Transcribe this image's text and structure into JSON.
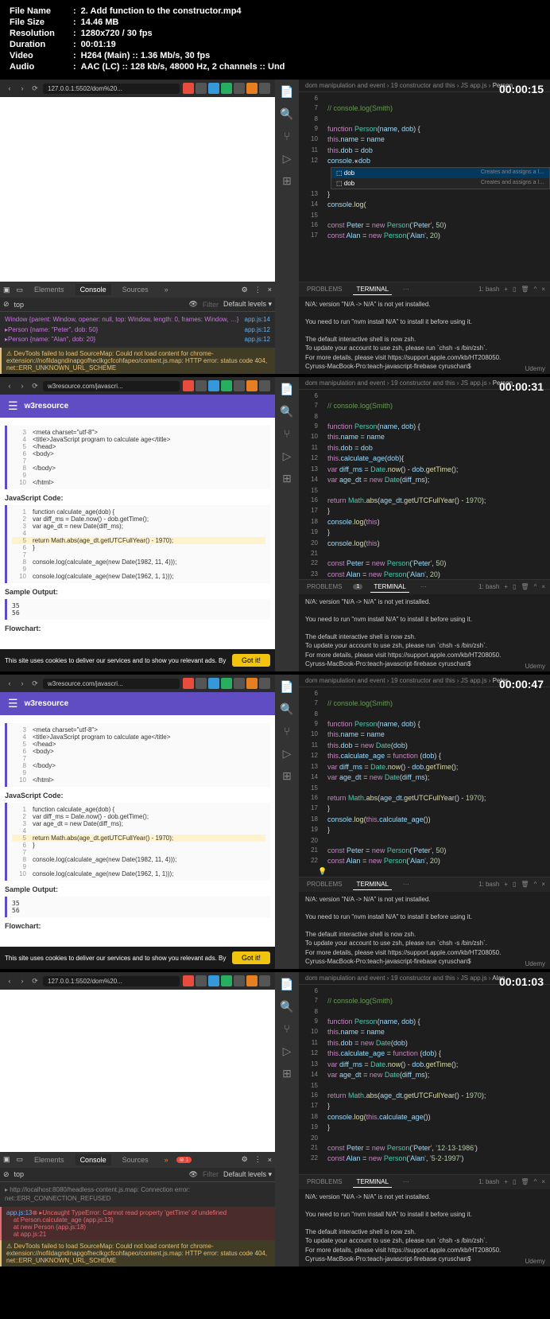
{
  "meta": {
    "file_name_label": "File Name",
    "file_name": "2. Add function to the constructor.mp4",
    "file_size_label": "File Size",
    "file_size": "14.46 MB",
    "resolution_label": "Resolution",
    "resolution": "1280x720 / 30 fps",
    "duration_label": "Duration",
    "duration": "00:01:19",
    "video_label": "Video",
    "video": "H264 (Main) :: 1.36 Mb/s, 30 fps",
    "audio_label": "Audio",
    "audio": "AAC (LC) :: 128 kb/s, 48000 Hz, 2 channels :: Und"
  },
  "timestamps": [
    "00:00:15",
    "00:00:31",
    "00:00:47",
    "00:01:03"
  ],
  "urls": {
    "local": "127.0.0.1:5502/dom%20...",
    "w3": "w3resource.com/javascri..."
  },
  "devtools": {
    "tabs": {
      "elements": "Elements",
      "console": "Console",
      "sources": "Sources",
      "more": "»"
    },
    "top": "top",
    "filter": "Filter",
    "levels": "Default levels ▾",
    "log1": "Window {parent: Window, opener: null, top: Window, length: 0, frames: Window, …}",
    "log2": "▸Person {name: \"Peter\", dob: 50}",
    "log3": "▸Person {name: \"Alan\", dob: 20}",
    "link1": "app.js:14",
    "link2": "app.js:12",
    "link3": "app.js:12",
    "warn": "⚠ DevTools failed to load SourceMap: Could not load content for chrome-extension://nofildagndinapgofheclkgcfcohfapeo/content.js.map: HTTP error: status code 404, net::ERR_UNKNOWN_URL_SCHEME",
    "err1": "▸ http://localhost:8080/headless-content.js.map: Connection error: net::ERR_CONNECTION_REFUSED",
    "err2": "⊗ ▸Uncaught TypeError: Cannot read property 'getTime' of undefined\n    at Person.calculate_age (app.js:13)\n    at new Person (app.js:18)\n    at app.js:21",
    "err2_links": "app.js:13"
  },
  "w3": {
    "title": "w3resource",
    "html_lines": [
      {
        "n": "3",
        "t": "    <meta charset=\"utf-8\">"
      },
      {
        "n": "4",
        "t": "    <title>JavaScript program to calculate age</title>"
      },
      {
        "n": "5",
        "t": "  </head>"
      },
      {
        "n": "6",
        "t": "  <body>"
      },
      {
        "n": "7",
        "t": ""
      },
      {
        "n": "8",
        "t": "  </body>"
      },
      {
        "n": "9",
        "t": ""
      },
      {
        "n": "10",
        "t": "</html>"
      }
    ],
    "js_title": "JavaScript Code:",
    "js_lines": [
      {
        "n": "1",
        "t": "function calculate_age(dob) {"
      },
      {
        "n": "2",
        "t": "    var diff_ms = Date.now() - dob.getTime();"
      },
      {
        "n": "3",
        "t": "    var age_dt = new Date(diff_ms);"
      },
      {
        "n": "4",
        "t": ""
      },
      {
        "n": "5",
        "t": "    return Math.abs(age_dt.getUTCFullYear() - 1970);",
        "hl": true
      },
      {
        "n": "6",
        "t": "}"
      },
      {
        "n": "7",
        "t": ""
      },
      {
        "n": "8",
        "t": "console.log(calculate_age(new Date(1982, 11, 4)));"
      },
      {
        "n": "9",
        "t": ""
      },
      {
        "n": "10",
        "t": "console.log(calculate_age(new Date(1962, 1, 1)));"
      }
    ],
    "sample": "Sample Output:",
    "output": "35\n56",
    "flowchart": "Flowchart:",
    "cookie": "This site uses cookies to deliver our services and to show you relevant ads. By",
    "gotit": "Got it!"
  },
  "vscode": {
    "breadcrumb": "dom manipulation and event › 19 constructor and this › JS app.js ›",
    "bc_end": [
      "Person",
      "Person",
      "Peter",
      "Alan"
    ],
    "terminal": {
      "problems": "PROBLEMS",
      "terminal_tab": "TERMINAL",
      "dots": "···",
      "bash": "1: bash",
      "line1": "N/A: version \"N/A -> N/A\" is not yet installed.",
      "line2": "You need to run \"nvm install N/A\" to install it before using it.",
      "line3": "The default interactive shell is now zsh.",
      "line4": "To update your account to use zsh, please run `chsh -s /bin/zsh`.",
      "line5": "For more details, please visit https://support.apple.com/kb/HT208050.",
      "line6": "Cyruss-MacBook-Pro:teach-javascript-firebase cyruschan$"
    },
    "frame1": [
      {
        "n": "6",
        "t": ""
      },
      {
        "n": "7",
        "t": "// console.log(Smith)",
        "cls": "com"
      },
      {
        "n": "8",
        "t": ""
      },
      {
        "n": "9",
        "t": "function Person(name, dob) {"
      },
      {
        "n": "10",
        "t": "    this.name = name"
      },
      {
        "n": "11",
        "t": "    this.dob = dob"
      },
      {
        "n": "12",
        "t": "    console.⚹dob"
      },
      {
        "n": "13",
        "t": "}"
      },
      {
        "n": "14",
        "t": "console.log("
      },
      {
        "n": "15",
        "t": ""
      },
      {
        "n": "16",
        "t": "const Peter = new Person('Peter', 50)"
      },
      {
        "n": "17",
        "t": "const Alan = new Person('Alan', 20)"
      }
    ],
    "ac_items": [
      {
        "t": "dob",
        "hint": "Creates and assigns a l…"
      },
      {
        "t": "dob",
        "hint": "Creates and assigns a l…"
      }
    ],
    "frame2": [
      {
        "n": "6",
        "t": ""
      },
      {
        "n": "7",
        "t": "// console.log(Smith)",
        "cls": "com"
      },
      {
        "n": "8",
        "t": ""
      },
      {
        "n": "9",
        "t": "function Person(name, dob) {"
      },
      {
        "n": "10",
        "t": "    this.name = name"
      },
      {
        "n": "11",
        "t": "    this.dob = dob"
      },
      {
        "n": "12",
        "t": "    this.calculate_age(dob){"
      },
      {
        "n": "13",
        "t": "        var diff_ms = Date.now() - dob.getTime();"
      },
      {
        "n": "14",
        "t": "        var age_dt = new Date(diff_ms);"
      },
      {
        "n": "15",
        "t": ""
      },
      {
        "n": "16",
        "t": "        return Math.abs(age_dt.getUTCFullYear() - 1970);"
      },
      {
        "n": "17",
        "t": "    }"
      },
      {
        "n": "18",
        "t": "    console.log(this)"
      },
      {
        "n": "19",
        "t": "}"
      },
      {
        "n": "20",
        "t": "console.log(this)"
      },
      {
        "n": "21",
        "t": ""
      },
      {
        "n": "22",
        "t": "const Peter = new Person('Peter', 50)"
      },
      {
        "n": "23",
        "t": "const Alan = new Person('Alan', 20)"
      }
    ],
    "frame3": [
      {
        "n": "6",
        "t": ""
      },
      {
        "n": "7",
        "t": "// console.log(Smith)",
        "cls": "com"
      },
      {
        "n": "8",
        "t": ""
      },
      {
        "n": "9",
        "t": "function Person(name, dob) {"
      },
      {
        "n": "10",
        "t": "    this.name = name"
      },
      {
        "n": "11",
        "t": "    this.dob = new Date(dob)"
      },
      {
        "n": "12",
        "t": "    this.calculate_age = function (dob) {"
      },
      {
        "n": "13",
        "t": "        var diff_ms = Date.now() - dob.getTime();"
      },
      {
        "n": "14",
        "t": "        var age_dt = new Date(diff_ms);"
      },
      {
        "n": "15",
        "t": ""
      },
      {
        "n": "16",
        "t": "        return Math.abs(age_dt.getUTCFullYear() - 1970);"
      },
      {
        "n": "17",
        "t": "    }"
      },
      {
        "n": "18",
        "t": "    console.log(this.calculate_age())"
      },
      {
        "n": "19",
        "t": "}"
      },
      {
        "n": "20",
        "t": ""
      },
      {
        "n": "21",
        "t": "const Peter = new Person('Peter', 50)"
      },
      {
        "n": "22",
        "t": "const Alan = new Person('Alan', 20)"
      }
    ],
    "frame4": [
      {
        "n": "6",
        "t": ""
      },
      {
        "n": "7",
        "t": "// console.log(Smith)",
        "cls": "com"
      },
      {
        "n": "8",
        "t": ""
      },
      {
        "n": "9",
        "t": "function Person(name, dob) {"
      },
      {
        "n": "10",
        "t": "    this.name = name"
      },
      {
        "n": "11",
        "t": "    this.dob = new Date(dob)"
      },
      {
        "n": "12",
        "t": "    this.calculate_age = function (dob) {"
      },
      {
        "n": "13",
        "t": "        var diff_ms = Date.now() - dob.getTime();"
      },
      {
        "n": "14",
        "t": "        var age_dt = new Date(diff_ms);"
      },
      {
        "n": "15",
        "t": ""
      },
      {
        "n": "16",
        "t": "        return Math.abs(age_dt.getUTCFullYear() - 1970);"
      },
      {
        "n": "17",
        "t": "    }"
      },
      {
        "n": "18",
        "t": "    console.log(this.calculate_age())"
      },
      {
        "n": "19",
        "t": "}"
      },
      {
        "n": "20",
        "t": ""
      },
      {
        "n": "21",
        "t": "const Peter = new Person('Peter', '12-13-1986')"
      },
      {
        "n": "22",
        "t": "const Alan = new Person('Alan', '5-2-1997')"
      }
    ]
  },
  "udemy": "Udemy"
}
